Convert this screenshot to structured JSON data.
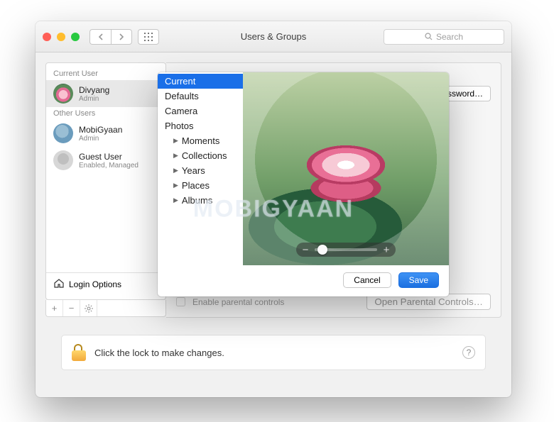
{
  "titlebar": {
    "window_title": "Users & Groups",
    "search_placeholder": "Search"
  },
  "sidebar": {
    "current_user_label": "Current User",
    "other_users_label": "Other Users",
    "users": [
      {
        "name": "Divyang",
        "role": "Admin"
      },
      {
        "name": "MobiGyaan",
        "role": "Admin"
      },
      {
        "name": "Guest User",
        "role": "Enabled, Managed"
      }
    ],
    "login_options_label": "Login Options"
  },
  "main": {
    "change_password_label": "Change Password…",
    "parental_controls_label": "Enable parental controls",
    "open_parental_label": "Open Parental Controls…"
  },
  "popover": {
    "sources": {
      "current": "Current",
      "defaults": "Defaults",
      "camera": "Camera",
      "photos": "Photos",
      "moments": "Moments",
      "collections": "Collections",
      "years": "Years",
      "places": "Places",
      "albums": "Albums"
    },
    "cancel_label": "Cancel",
    "save_label": "Save"
  },
  "footer": {
    "lock_text": "Click the lock to make changes."
  },
  "watermark": "MOBIGYAAN"
}
